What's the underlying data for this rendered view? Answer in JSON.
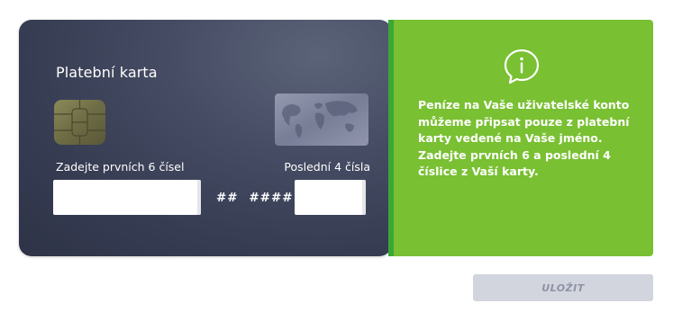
{
  "card": {
    "title": "Platební karta",
    "first_digits_label": "Zadejte prvních 6 čísel",
    "last_digits_label": "Poslední 4 čísla",
    "first_digits_value": "",
    "last_digits_value": "",
    "masked_middle": "## ####",
    "colors": {
      "background": "#3a4056"
    }
  },
  "info": {
    "icon": "chat-info-icon",
    "text": "Peníze na Vaše uživatelské konto můžeme připsat pouze z platební karty vedené na Vaše jméno. Zadejte prvních 6 a poslední 4 číslice z Vaší karty.",
    "colors": {
      "background": "#79c032"
    }
  },
  "actions": {
    "save_label": "ULOŽIT",
    "save_state": "disabled"
  }
}
